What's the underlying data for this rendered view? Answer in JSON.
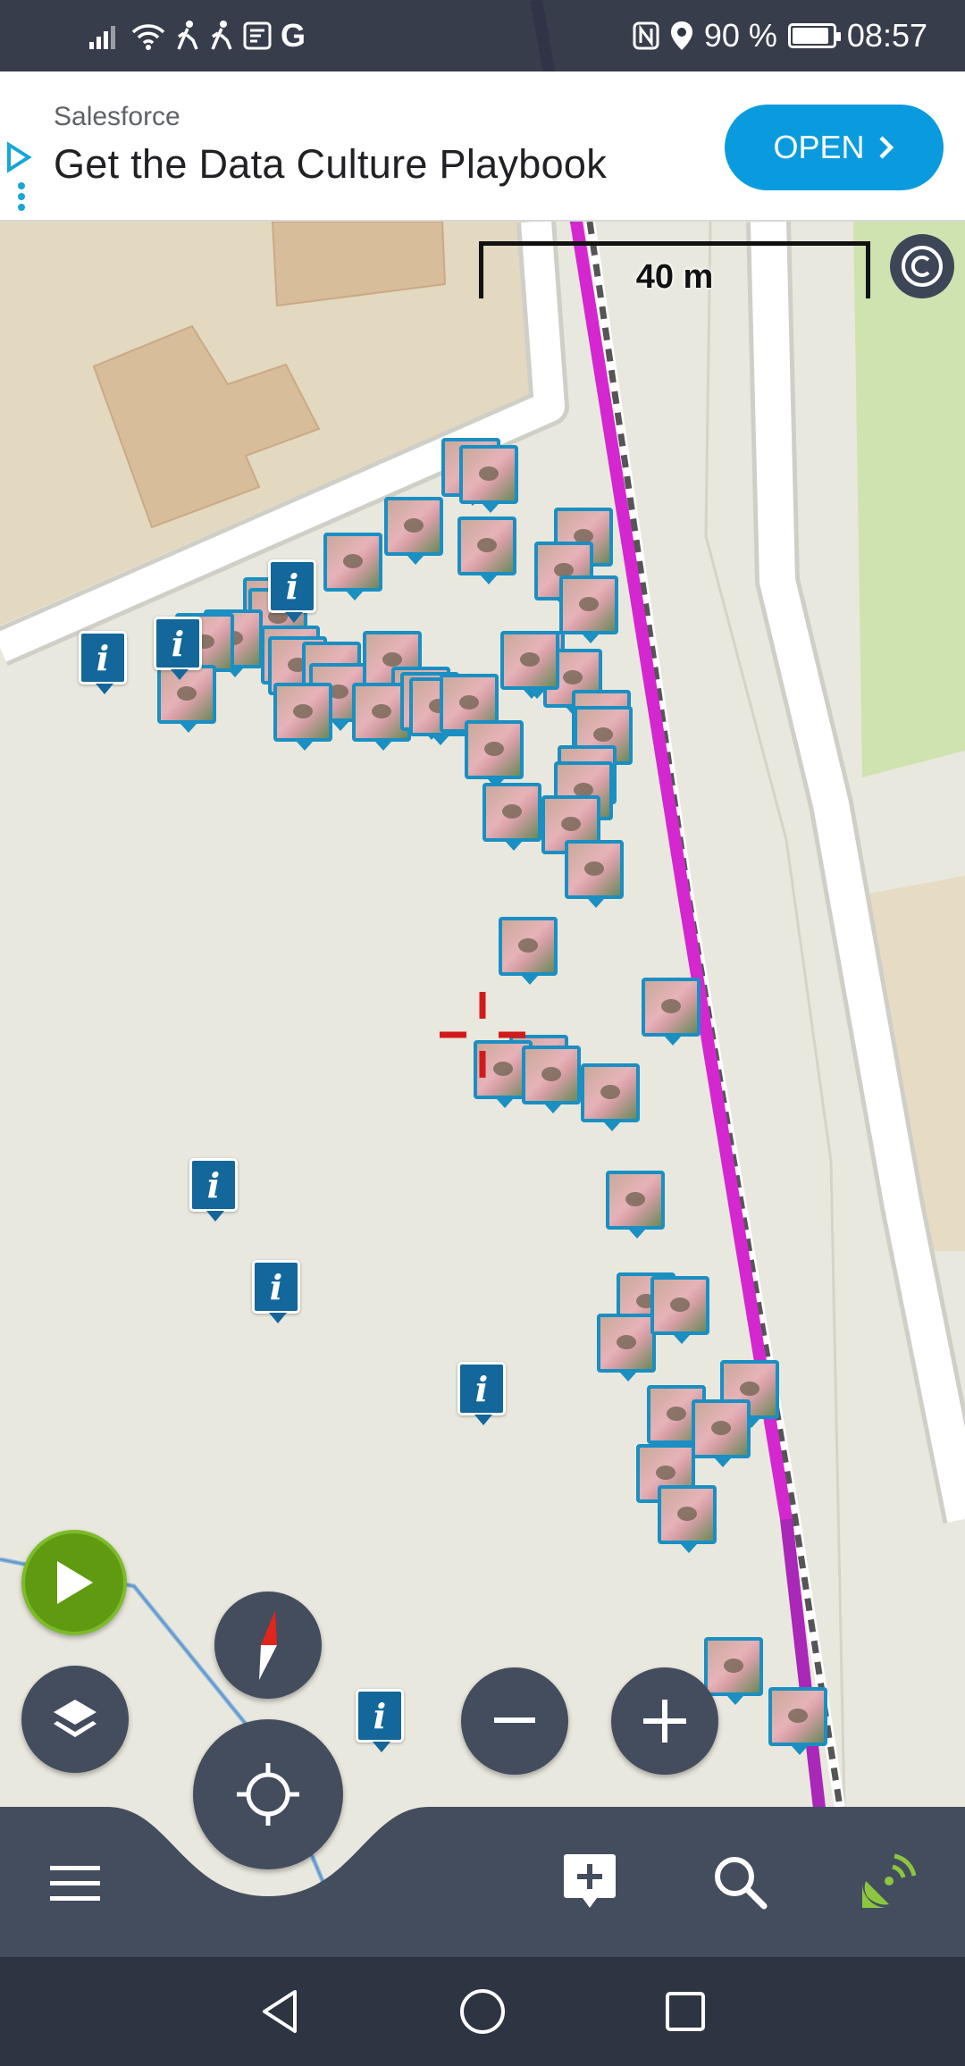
{
  "status_bar": {
    "carrier_icon": "G",
    "battery_text": "90 %",
    "battery_level_percent": 90,
    "time": "08:57"
  },
  "ad": {
    "advertiser": "Salesforce",
    "headline": "Get the Data Culture Playbook",
    "cta_label": "OPEN"
  },
  "map": {
    "scale_label": "40 m",
    "copyright_icon": "copyright-icon",
    "crosshair_icon": "crosshair-icon",
    "photo_marker_count": 57,
    "info_marker_count": 7,
    "info_marker_glyph": "i"
  },
  "controls": {
    "play_icon": "play-icon",
    "compass_icon": "compass-icon",
    "layers_icon": "layers-icon",
    "locate_icon": "locate-icon",
    "zoom_out_icon": "minus-icon",
    "zoom_in_icon": "plus-icon"
  },
  "toolbar": {
    "menu_icon": "menu-icon",
    "add_note_icon": "add-note-icon",
    "search_icon": "search-icon",
    "gps_icon": "gps-satellite-icon"
  },
  "navigation": {
    "back_icon": "back-icon",
    "home_icon": "home-icon",
    "recents_icon": "recents-icon"
  },
  "colors": {
    "map_background": "#e9e8de",
    "road": "#ffffff",
    "building": "#d8bd9b",
    "track_magenta": "#d427cf",
    "marker_blue": "#1a8fc2",
    "info_blue": "#13679a",
    "play_green": "#5f9a10",
    "gps_green": "#8cc63f",
    "crosshair_red": "#d11a1a",
    "control_dark": "#434d5e"
  }
}
